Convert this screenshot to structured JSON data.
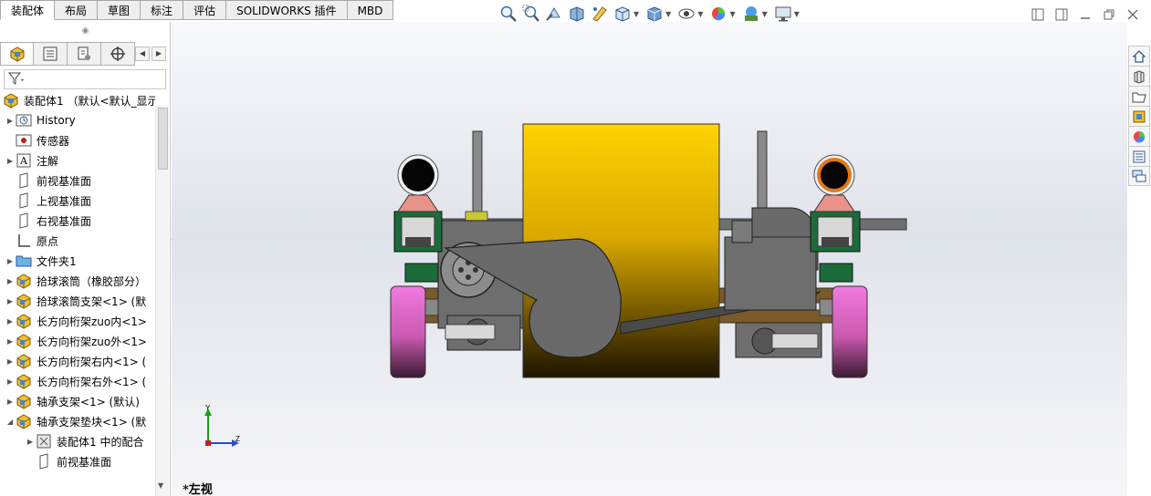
{
  "tabs": [
    {
      "label": "装配体",
      "active": true
    },
    {
      "label": "布局",
      "active": false
    },
    {
      "label": "草图",
      "active": false
    },
    {
      "label": "标注",
      "active": false
    },
    {
      "label": "评估",
      "active": false
    },
    {
      "label": "SOLIDWORKS 插件",
      "active": false
    },
    {
      "label": "MBD",
      "active": false
    }
  ],
  "hud_toolbar": [
    "zoom-to-fit-icon",
    "zoom-to-area-icon",
    "previous-view-icon",
    "section-view-icon",
    "dynamic-annotation-icon",
    "view-orientation-icon",
    "display-style-icon",
    "hide-show-icon",
    "edit-appearance-icon",
    "apply-scene-icon",
    "view-settings-icon"
  ],
  "feature_tree": {
    "root_label": "装配体1 （默认<默认_显示",
    "items": [
      {
        "label": "History",
        "icon": "history-icon",
        "expandable": true,
        "indent": 0
      },
      {
        "label": "传感器",
        "icon": "sensor-icon",
        "expandable": false,
        "indent": 0
      },
      {
        "label": "注解",
        "icon": "annotation-icon",
        "expandable": true,
        "indent": 0
      },
      {
        "label": "前视基准面",
        "icon": "plane-icon",
        "expandable": false,
        "indent": 0
      },
      {
        "label": "上视基准面",
        "icon": "plane-icon",
        "expandable": false,
        "indent": 0
      },
      {
        "label": "右视基准面",
        "icon": "plane-icon",
        "expandable": false,
        "indent": 0
      },
      {
        "label": "原点",
        "icon": "origin-icon",
        "expandable": false,
        "indent": 0
      },
      {
        "label": "文件夹1",
        "icon": "folder-icon",
        "expandable": true,
        "indent": 0
      },
      {
        "label": "拾球滚筒（橡胶部分）",
        "icon": "part-icon",
        "expandable": true,
        "indent": 0
      },
      {
        "label": "拾球滚筒支架<1> (默",
        "icon": "part-icon",
        "expandable": true,
        "indent": 0
      },
      {
        "label": "长方向桁架zuo内<1>",
        "icon": "part-icon",
        "expandable": true,
        "indent": 0
      },
      {
        "label": "长方向桁架zuo外<1>",
        "icon": "part-icon",
        "expandable": true,
        "indent": 0
      },
      {
        "label": "长方向桁架右内<1> (",
        "icon": "part-icon",
        "expandable": true,
        "indent": 0
      },
      {
        "label": "长方向桁架右外<1> (",
        "icon": "part-icon",
        "expandable": true,
        "indent": 0
      },
      {
        "label": "轴承支架<1> (默认)",
        "icon": "part-icon",
        "expandable": true,
        "indent": 0
      },
      {
        "label": "轴承支架垫块<1> (默",
        "icon": "part-icon",
        "expandable": true,
        "expanded": true,
        "indent": 0
      },
      {
        "label": "装配体1 中的配合",
        "icon": "mates-icon",
        "expandable": true,
        "indent": 1
      },
      {
        "label": "前视基准面",
        "icon": "plane-icon",
        "expandable": false,
        "indent": 1
      }
    ]
  },
  "triad": {
    "y_label": "Y",
    "z_label": "Z"
  },
  "view_name": "*左视",
  "task_pane": [
    "home-icon",
    "design-library-icon",
    "file-explorer-icon",
    "view-palette-icon",
    "appearances-icon",
    "custom-properties-icon",
    "forum-icon"
  ],
  "colors": {
    "roller": "#f6c900",
    "wheel": "#e66ad6",
    "frame": "#5e5e5e",
    "bracket": "#1c6b3a",
    "panel_border": "#c8c8c8"
  }
}
